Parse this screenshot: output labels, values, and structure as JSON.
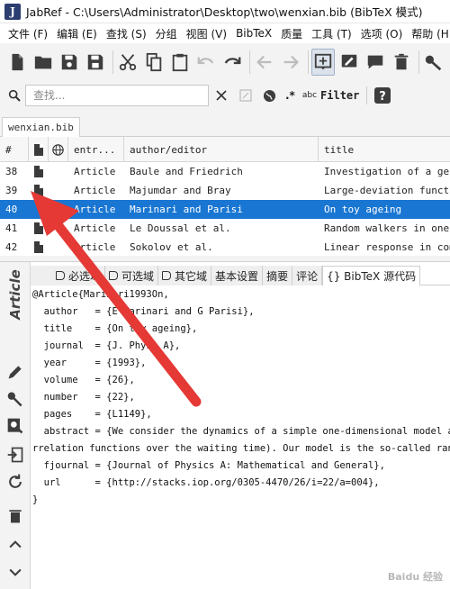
{
  "window": {
    "title": "JabRef - C:\\Users\\Administrator\\Desktop\\two\\wenxian.bib (BibTeX 模式)",
    "logo": "J"
  },
  "menu": [
    "文件 (F)",
    "编辑 (E)",
    "查找 (S)",
    "分组",
    "视图 (V)",
    "BibTeX",
    "质量",
    "工具 (T)",
    "选项 (O)",
    "帮助 (H)"
  ],
  "search": {
    "placeholder": "查找...",
    "filter_label": "Filter",
    "regex_label": ".*",
    "case_label": "abc"
  },
  "file_tab": "wenxian.bib",
  "table": {
    "headers": [
      "#",
      "",
      "",
      "entr...",
      "author/editor",
      "title"
    ],
    "rows": [
      {
        "num": "38",
        "type": "Article",
        "author": "Baule and Friedrich",
        "title": "Investigation of a gener"
      },
      {
        "num": "39",
        "type": "Article",
        "author": "Majumdar and Bray",
        "title": "Large-deviation function"
      },
      {
        "num": "40",
        "type": "Article",
        "author": "Marinari and Parisi",
        "title": "On toy ageing",
        "selected": true
      },
      {
        "num": "41",
        "type": "Article",
        "author": "Le Doussal et al.",
        "title": "Random walkers in one-di"
      },
      {
        "num": "42",
        "type": "Article",
        "author": "Sokolov et al.",
        "title": "Linear response in compl"
      }
    ]
  },
  "editor": {
    "side_label": "Article",
    "tabs": [
      "必选域",
      "可选域",
      "其它域",
      "基本设置",
      "摘要",
      "评论",
      "{} BibTeX 源代码"
    ],
    "source_lines": [
      "@Article{Marinari1993On,",
      "  author   = {E Marinari and G Parisi},",
      "  title    = {On toy ageing},",
      "  journal  = {J. Phys. A},",
      "  year     = {1993},",
      "  volume   = {26},",
      "  number   = {22},",
      "  pages    = {L1149},",
      "  abstract = {We consider the dynamics of a simple one-dimensional model and w",
      "rrelation functions over the waiting time). Our model is the so-called random",
      "  fjournal = {Journal of Physics A: Mathematical and General},",
      "  url      = {http://stacks.iop.org/0305-4470/26/i=22/a=004},",
      "}"
    ]
  },
  "watermark": "Baidu 经验",
  "colors": {
    "selection": "#1976d2",
    "arrow": "#e53935"
  }
}
